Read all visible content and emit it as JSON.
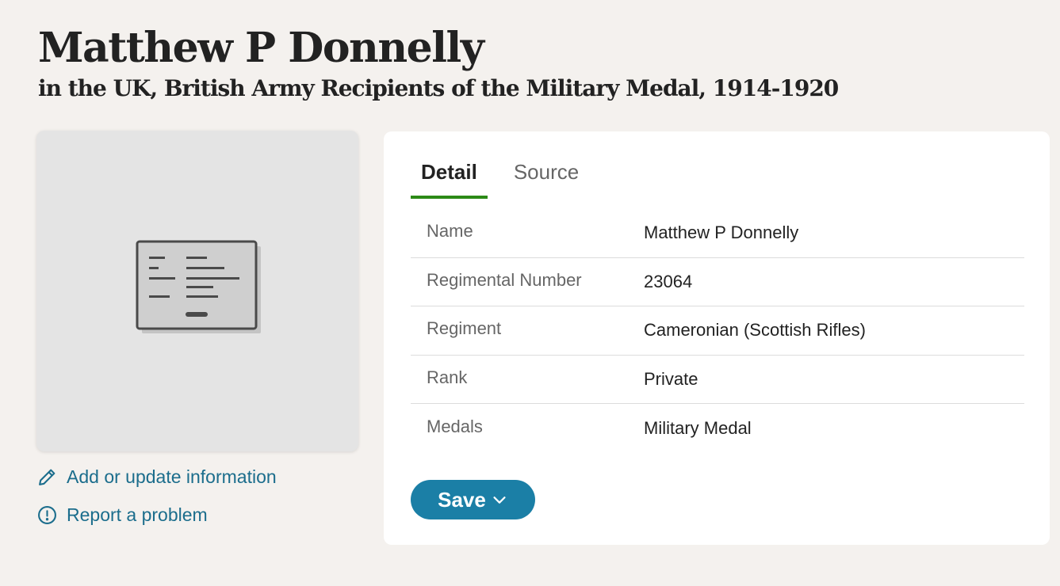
{
  "header": {
    "title": "Matthew P Donnelly",
    "subtitle": "in the UK, British Army Recipients of the Military Medal, 1914-1920"
  },
  "links": {
    "edit": {
      "label": "Add or update information",
      "icon": "pencil-icon"
    },
    "report": {
      "label": "Report a problem",
      "icon": "alert-circle-icon"
    }
  },
  "tabs": [
    {
      "label": "Detail",
      "active": true
    },
    {
      "label": "Source",
      "active": false
    }
  ],
  "details": [
    {
      "label": "Name",
      "value": "Matthew P Donnelly"
    },
    {
      "label": "Regimental Number",
      "value": "23064"
    },
    {
      "label": "Regiment",
      "value": "Cameronian (Scottish Rifles)"
    },
    {
      "label": "Rank",
      "value": "Private"
    },
    {
      "label": "Medals",
      "value": "Military Medal"
    }
  ],
  "actions": {
    "save_label": "Save",
    "save_icon": "chevron-down-icon"
  },
  "colors": {
    "accent_link": "#1b6d8c",
    "save_button": "#1b7fa6",
    "active_tab_underline": "#2b8a16",
    "page_bg": "#f4f1ee"
  }
}
